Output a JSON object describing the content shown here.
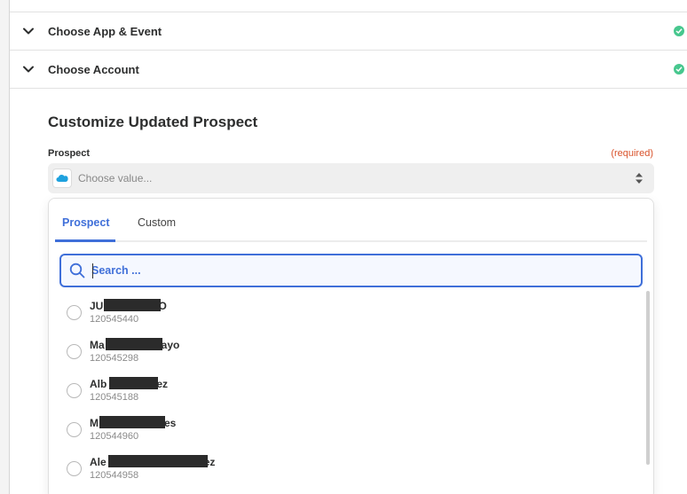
{
  "steps": [
    {
      "title": "Choose App & Event",
      "status": "complete"
    },
    {
      "title": "Choose Account",
      "status": "complete"
    }
  ],
  "section": {
    "title": "Customize Updated Prospect"
  },
  "field": {
    "label": "Prospect",
    "required": "(required)",
    "placeholder": "Choose value...",
    "app_icon": "salesforce-cloud-icon"
  },
  "dropdown": {
    "tabs": [
      {
        "label": "Prospect",
        "active": true
      },
      {
        "label": "Custom",
        "active": false
      }
    ],
    "search_placeholder": "Search ...",
    "items": [
      {
        "name_start": "JU",
        "name_end": "TO",
        "id": "120545440"
      },
      {
        "name_start": "Ma",
        "name_end": "ayo",
        "id": "120545298"
      },
      {
        "name_start": "Alb",
        "name_end": "ez",
        "id": "120545188"
      },
      {
        "name_start": "M",
        "name_end": "es",
        "id": "120544960"
      },
      {
        "name_start": "Ale",
        "name_end": "ez",
        "id": "120544958"
      }
    ]
  },
  "colors": {
    "accent": "#3f6fd9",
    "success": "#47c78e",
    "required": "#d9532c"
  }
}
